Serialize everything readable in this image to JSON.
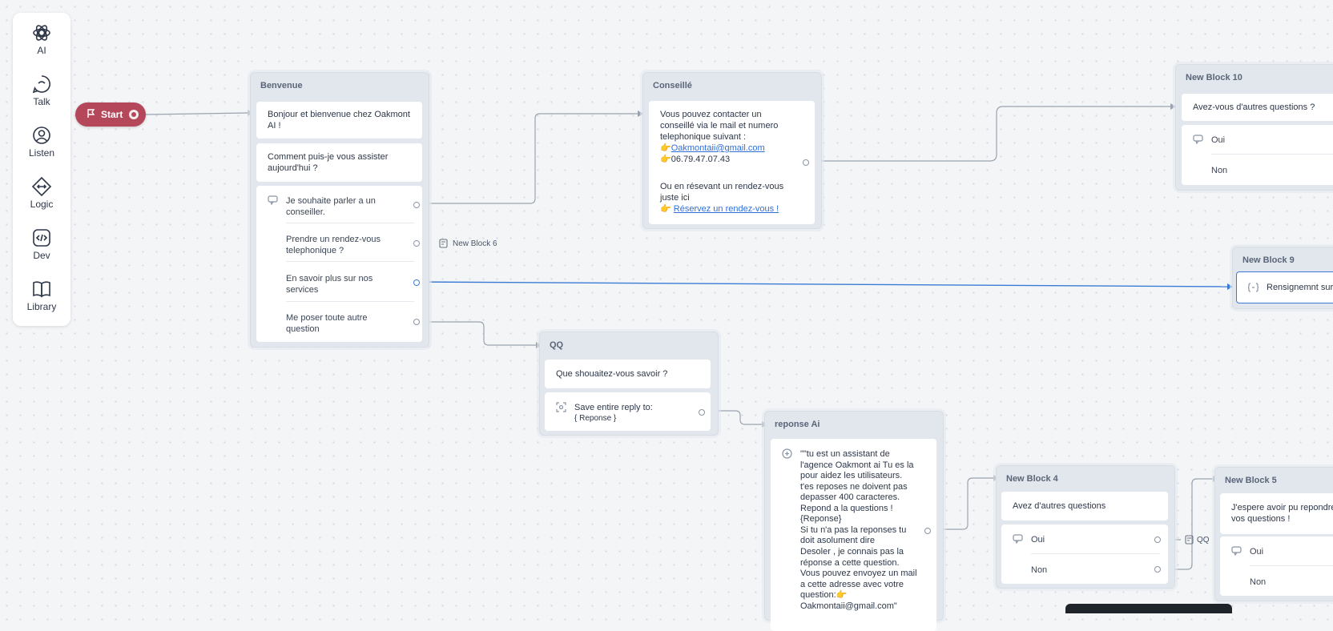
{
  "toolbar": {
    "items": [
      {
        "label": "AI",
        "icon": "openai-icon"
      },
      {
        "label": "Talk",
        "icon": "chat-bubble-icon"
      },
      {
        "label": "Listen",
        "icon": "user-circle-icon"
      },
      {
        "label": "Logic",
        "icon": "diamond-arrows-icon"
      },
      {
        "label": "Dev",
        "icon": "code-icon"
      },
      {
        "label": "Library",
        "icon": "book-icon"
      }
    ]
  },
  "start": {
    "label": "Start"
  },
  "benvenue": {
    "title": "Benvenue",
    "msg1": [
      "Bonjour et bienvenue chez Oakmont",
      "AI !"
    ],
    "msg2": [
      "Comment puis-je vous assister",
      "aujourd'hui ?"
    ],
    "choices": [
      [
        "Je souhaite parler a un",
        "conseiller."
      ],
      [
        "Prendre un rendez-vous",
        "telephonique ?"
      ],
      [
        "En savoir plus sur nos",
        "services"
      ],
      [
        "Me poser toute autre",
        "question"
      ]
    ],
    "choice2_target": "New Block 6"
  },
  "conseille": {
    "title": "Conseillé",
    "lines": [
      "Vous pouvez contacter un",
      "conseillé via le mail et numero",
      "telephonique suivant :"
    ],
    "email_prefix": "👉",
    "email": "Oakmontaii@gmail.com",
    "phone_line": "👉06.79.47.07.43",
    "rdv_lines": [
      "Ou en résevant un rendez-vous",
      "juste ici"
    ],
    "rdv_prefix": "👉",
    "rdv_link": "Réservez un rendez-vous !"
  },
  "block10": {
    "title": "New Block 10",
    "question": "Avez-vous d'autres questions ?",
    "choices": [
      "Oui",
      "Non"
    ]
  },
  "block9": {
    "title": "New Block 9",
    "item": "Rensignemnt sur"
  },
  "qq": {
    "title": "QQ",
    "question": "Que shouaitez-vous savoir ?",
    "save_label": "Save entire reply to:",
    "save_var": "{ Reponse }"
  },
  "reponse_ai": {
    "title": "reponse Ai",
    "lines": [
      "\"\"tu est un assistant de",
      "l'agence Oakmont ai Tu es la",
      "pour aidez les utilisateurs.",
      "t'es reposes ne doivent pas",
      "depasser 400 caracteres.",
      "Repond a la questions !",
      "{Reponse}",
      "Si tu n'a pas la reponses tu",
      "doit asolument dire",
      "Desoler , je connais pas la",
      "réponse a cette question.",
      "Vous pouvez envoyez un mail",
      "a cette adresse avec votre",
      "question:👉",
      "Oakmontaii@gmail.com\""
    ]
  },
  "block4": {
    "title": "New Block 4",
    "question": "Avez d'autres questions",
    "choices": [
      "Oui",
      "Non"
    ],
    "oui_target": "QQ"
  },
  "block5": {
    "title": "New Block 5",
    "lines": [
      "J'espere avoir pu repondre",
      "vos questions !"
    ],
    "choices": [
      "Oui",
      "Non"
    ]
  }
}
